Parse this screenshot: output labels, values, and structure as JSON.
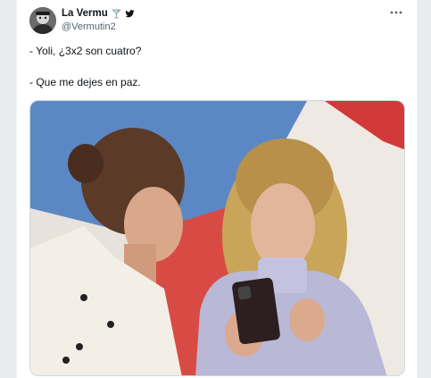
{
  "tweet": {
    "display_name": "La Vermu",
    "handle": "@Vermutin2",
    "text_line1": "- Yoli, ¿3x2 son cuatro?",
    "text_line2": "- Que me dejes en paz."
  },
  "icons": {
    "avatar": "avatar-photo",
    "name_emoji": "cocktail-glass-icon",
    "verified": "bird-icon",
    "more": "more-options-icon"
  },
  "colors": {
    "text_primary": "#0f1419",
    "text_secondary": "#536471",
    "media_blue": "#5b88c4",
    "media_red": "#d23a3a"
  }
}
